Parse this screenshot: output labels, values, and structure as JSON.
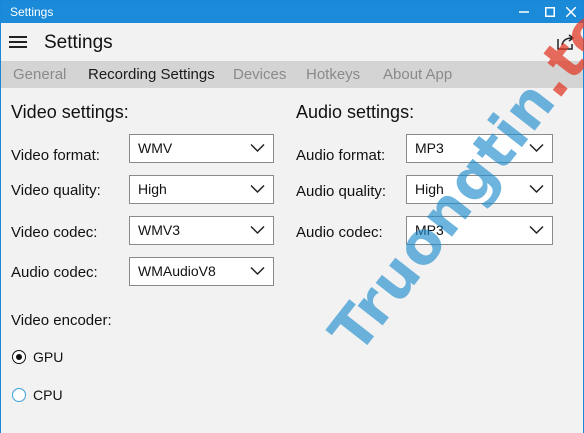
{
  "window": {
    "title": "Settings"
  },
  "header": {
    "title": "Settings"
  },
  "tabs": [
    {
      "label": "General",
      "active": false
    },
    {
      "label": "Recording Settings",
      "active": true
    },
    {
      "label": "Devices",
      "active": false
    },
    {
      "label": "Hotkeys",
      "active": false
    },
    {
      "label": "About App",
      "active": false
    }
  ],
  "video": {
    "title": "Video settings:",
    "format": {
      "label": "Video format:",
      "value": "WMV"
    },
    "quality": {
      "label": "Video quality:",
      "value": "High"
    },
    "codec": {
      "label": "Video codec:",
      "value": "WMV3"
    },
    "audio_codec": {
      "label": "Audio codec:",
      "value": "WMAudioV8"
    },
    "encoder": {
      "label": "Video encoder:",
      "options": [
        {
          "label": "GPU",
          "selected": true
        },
        {
          "label": "CPU",
          "selected": false
        }
      ]
    }
  },
  "audio": {
    "title": "Audio settings:",
    "format": {
      "label": "Audio format:",
      "value": "MP3"
    },
    "quality": {
      "label": "Audio quality:",
      "value": "High"
    },
    "codec": {
      "label": "Audio codec:",
      "value": "MP3"
    }
  },
  "watermark": {
    "text": "Truongtin",
    "accent": ".top"
  },
  "colors": {
    "titlebar": "#1a8ad9",
    "tabbar": "#d4d4d4",
    "background": "#f2f2f2",
    "radio_unchecked": "#3aa0e0"
  }
}
